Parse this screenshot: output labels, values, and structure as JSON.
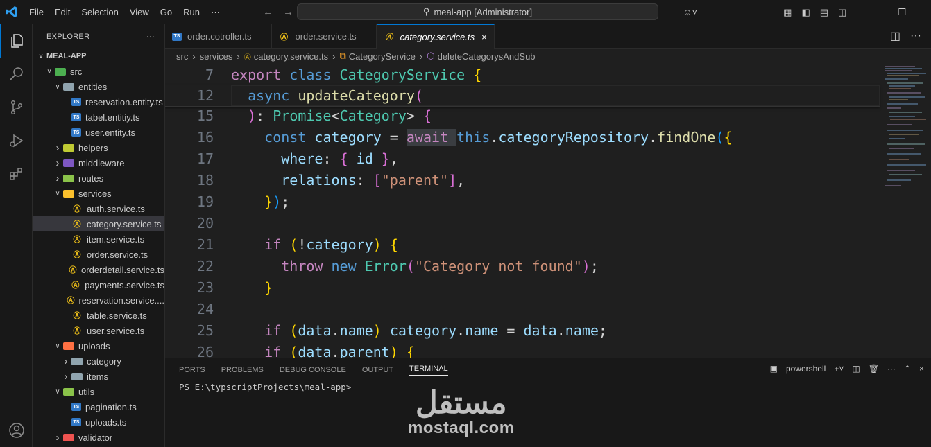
{
  "titlebar": {
    "menu": [
      "File",
      "Edit",
      "Selection",
      "View",
      "Go",
      "Run",
      "···"
    ],
    "search_text": "meal-app [Administrator]"
  },
  "sidebar": {
    "title": "EXPLORER",
    "more": "···",
    "rows": [
      {
        "label": "MEAL-APP",
        "depth": 0,
        "type": "root",
        "chev": "open"
      },
      {
        "label": "src",
        "depth": 1,
        "type": "folder",
        "chev": "open",
        "color": "#4caf50"
      },
      {
        "label": "entities",
        "depth": 2,
        "type": "folder",
        "chev": "open",
        "color": "#90a4ae"
      },
      {
        "label": "reservation.entity.ts",
        "depth": 3,
        "type": "ts"
      },
      {
        "label": "tabel.entitiy.ts",
        "depth": 3,
        "type": "ts"
      },
      {
        "label": "user.entity.ts",
        "depth": 3,
        "type": "ts"
      },
      {
        "label": "helpers",
        "depth": 2,
        "type": "folder",
        "chev": "closed",
        "color": "#c0ca33"
      },
      {
        "label": "middleware",
        "depth": 2,
        "type": "folder",
        "chev": "closed",
        "color": "#7e57c2"
      },
      {
        "label": "routes",
        "depth": 2,
        "type": "folder",
        "chev": "closed",
        "color": "#8bc34a"
      },
      {
        "label": "services",
        "depth": 2,
        "type": "folder",
        "chev": "open",
        "color": "#fbc02d"
      },
      {
        "label": "auth.service.ts",
        "depth": 3,
        "type": "ng"
      },
      {
        "label": "category.service.ts",
        "depth": 3,
        "type": "ng",
        "selected": true
      },
      {
        "label": "item.service.ts",
        "depth": 3,
        "type": "ng"
      },
      {
        "label": "order.service.ts",
        "depth": 3,
        "type": "ng"
      },
      {
        "label": "orderdetail.service.ts",
        "depth": 3,
        "type": "ng"
      },
      {
        "label": "payments.service.ts",
        "depth": 3,
        "type": "ng"
      },
      {
        "label": "reservation.service....",
        "depth": 3,
        "type": "ng"
      },
      {
        "label": "table.service.ts",
        "depth": 3,
        "type": "ng"
      },
      {
        "label": "user.service.ts",
        "depth": 3,
        "type": "ng"
      },
      {
        "label": "uploads",
        "depth": 2,
        "type": "folder",
        "chev": "open",
        "color": "#ff7043"
      },
      {
        "label": "category",
        "depth": 3,
        "type": "folder",
        "chev": "closed",
        "color": "#90a4ae"
      },
      {
        "label": "items",
        "depth": 3,
        "type": "folder",
        "chev": "closed",
        "color": "#90a4ae"
      },
      {
        "label": "utils",
        "depth": 2,
        "type": "folder",
        "chev": "open",
        "color": "#8bc34a"
      },
      {
        "label": "pagination.ts",
        "depth": 3,
        "type": "ts"
      },
      {
        "label": "uploads.ts",
        "depth": 3,
        "type": "ts"
      },
      {
        "label": "validator",
        "depth": 2,
        "type": "folder",
        "chev": "closed",
        "color": "#ef5350"
      }
    ]
  },
  "tabs": [
    {
      "label": "order.cotroller.ts",
      "icon": "ts",
      "active": false
    },
    {
      "label": "order.service.ts",
      "icon": "ng",
      "active": false
    },
    {
      "label": "category.service.ts",
      "icon": "ng",
      "active": true,
      "close": "×"
    }
  ],
  "breadcrumb": [
    "src",
    "services",
    "category.service.ts",
    "CategoryService",
    "deleteCategorysAndSub"
  ],
  "code_lines": [
    {
      "n": "7",
      "sticky": true,
      "tokens": [
        [
          "k1",
          "export "
        ],
        [
          "k2",
          "class "
        ],
        [
          "cls",
          "CategoryService "
        ],
        [
          "br1",
          "{"
        ]
      ]
    },
    {
      "n": "12",
      "sticky": true,
      "tokens": [
        [
          "pun",
          "  "
        ],
        [
          "k2",
          "async "
        ],
        [
          "fn",
          "updateCategory"
        ],
        [
          "br2",
          "("
        ]
      ]
    },
    {
      "n": "15",
      "tokens": [
        [
          "pun",
          "  "
        ],
        [
          "br2",
          ")"
        ],
        [
          "pun",
          ": "
        ],
        [
          "cls",
          "Promise"
        ],
        [
          "pun",
          "<"
        ],
        [
          "cls",
          "Category"
        ],
        [
          "pun",
          "> "
        ],
        [
          "br2",
          "{"
        ]
      ]
    },
    {
      "n": "16",
      "tokens": [
        [
          "pun",
          "    "
        ],
        [
          "k2",
          "const "
        ],
        [
          "var",
          "category "
        ],
        [
          "pun",
          "= "
        ],
        [
          "k1",
          "await "
        ],
        [
          "k2",
          "this"
        ],
        [
          "pun",
          "."
        ],
        [
          "var",
          "categoryRepository"
        ],
        [
          "pun",
          "."
        ],
        [
          "fn",
          "findOne"
        ],
        [
          "br3",
          "("
        ],
        [
          "br1",
          "{"
        ]
      ]
    },
    {
      "n": "17",
      "tokens": [
        [
          "pun",
          "      "
        ],
        [
          "var",
          "where"
        ],
        [
          "pun",
          ": "
        ],
        [
          "br2",
          "{ "
        ],
        [
          "var",
          "id "
        ],
        [
          "br2",
          "}"
        ],
        [
          "pun",
          ","
        ]
      ]
    },
    {
      "n": "18",
      "tokens": [
        [
          "pun",
          "      "
        ],
        [
          "var",
          "relations"
        ],
        [
          "pun",
          ": "
        ],
        [
          "br2",
          "["
        ],
        [
          "str",
          "\"parent\""
        ],
        [
          "br2",
          "]"
        ],
        [
          "pun",
          ","
        ]
      ]
    },
    {
      "n": "19",
      "tokens": [
        [
          "pun",
          "    "
        ],
        [
          "br1",
          "}"
        ],
        [
          "br3",
          ")"
        ],
        [
          "pun",
          ";"
        ]
      ]
    },
    {
      "n": "20",
      "tokens": []
    },
    {
      "n": "21",
      "tokens": [
        [
          "pun",
          "    "
        ],
        [
          "k1",
          "if "
        ],
        [
          "br1",
          "("
        ],
        [
          "pun",
          "!"
        ],
        [
          "var",
          "category"
        ],
        [
          "br1",
          ") "
        ],
        [
          "br1",
          "{"
        ]
      ]
    },
    {
      "n": "22",
      "tokens": [
        [
          "pun",
          "      "
        ],
        [
          "k1",
          "throw "
        ],
        [
          "k2",
          "new "
        ],
        [
          "cls",
          "Error"
        ],
        [
          "br2",
          "("
        ],
        [
          "str",
          "\"Category not found\""
        ],
        [
          "br2",
          ")"
        ],
        [
          "pun",
          ";"
        ]
      ]
    },
    {
      "n": "23",
      "tokens": [
        [
          "pun",
          "    "
        ],
        [
          "br1",
          "}"
        ]
      ]
    },
    {
      "n": "24",
      "tokens": []
    },
    {
      "n": "25",
      "tokens": [
        [
          "pun",
          "    "
        ],
        [
          "k1",
          "if "
        ],
        [
          "br1",
          "("
        ],
        [
          "var",
          "data"
        ],
        [
          "pun",
          "."
        ],
        [
          "var",
          "name"
        ],
        [
          "br1",
          ") "
        ],
        [
          "var",
          "category"
        ],
        [
          "pun",
          "."
        ],
        [
          "var",
          "name "
        ],
        [
          "pun",
          "= "
        ],
        [
          "var",
          "data"
        ],
        [
          "pun",
          "."
        ],
        [
          "var",
          "name"
        ],
        [
          "pun",
          ";"
        ]
      ]
    },
    {
      "n": "26",
      "tokens": [
        [
          "pun",
          "    "
        ],
        [
          "k1",
          "if "
        ],
        [
          "br1",
          "("
        ],
        [
          "var",
          "data"
        ],
        [
          "pun",
          "."
        ],
        [
          "var",
          "parent"
        ],
        [
          "br1",
          ") "
        ],
        [
          "br1",
          "{"
        ]
      ]
    }
  ],
  "panel": {
    "tabs": [
      "PORTS",
      "PROBLEMS",
      "DEBUG CONSOLE",
      "OUTPUT",
      "TERMINAL"
    ],
    "active_tab": "TERMINAL",
    "shell": "powershell",
    "prompt": "PS E:\\typscriptProjects\\meal-app>"
  },
  "watermark": {
    "arabic": "مستقل",
    "latin": "mostaql.com"
  }
}
